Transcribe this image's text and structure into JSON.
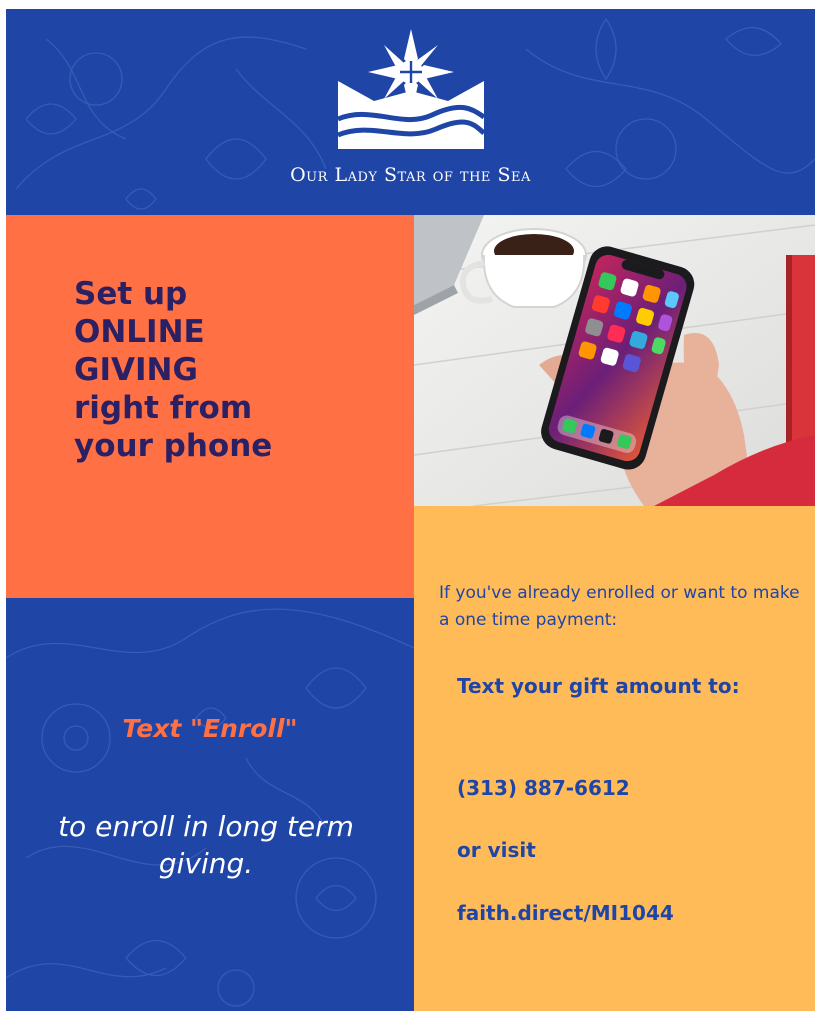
{
  "header": {
    "church_name": "Our Lady Star of the Sea"
  },
  "headline": {
    "lines": [
      "Set up",
      "ONLINE",
      "GIVING",
      "right from",
      "your phone"
    ]
  },
  "enroll": {
    "keyword": "Text \"Enroll\"",
    "description": "to enroll in long term giving."
  },
  "one_time": {
    "intro": "If you've already enrolled or want to  make a one time payment:",
    "instruction": "Text your gift amount to:",
    "phone": "(313) 887-6612",
    "or_visit": "or visit",
    "url": "faith.direct/MI1044"
  },
  "colors": {
    "blue": "#1f45a6",
    "orange": "#ff7145",
    "yellow": "#ffbb58",
    "navy_text": "#2a2063",
    "white": "#ffffff"
  },
  "icons": [
    "star-wave-logo-icon",
    "coffee-cup-icon",
    "smartphone-icon"
  ]
}
